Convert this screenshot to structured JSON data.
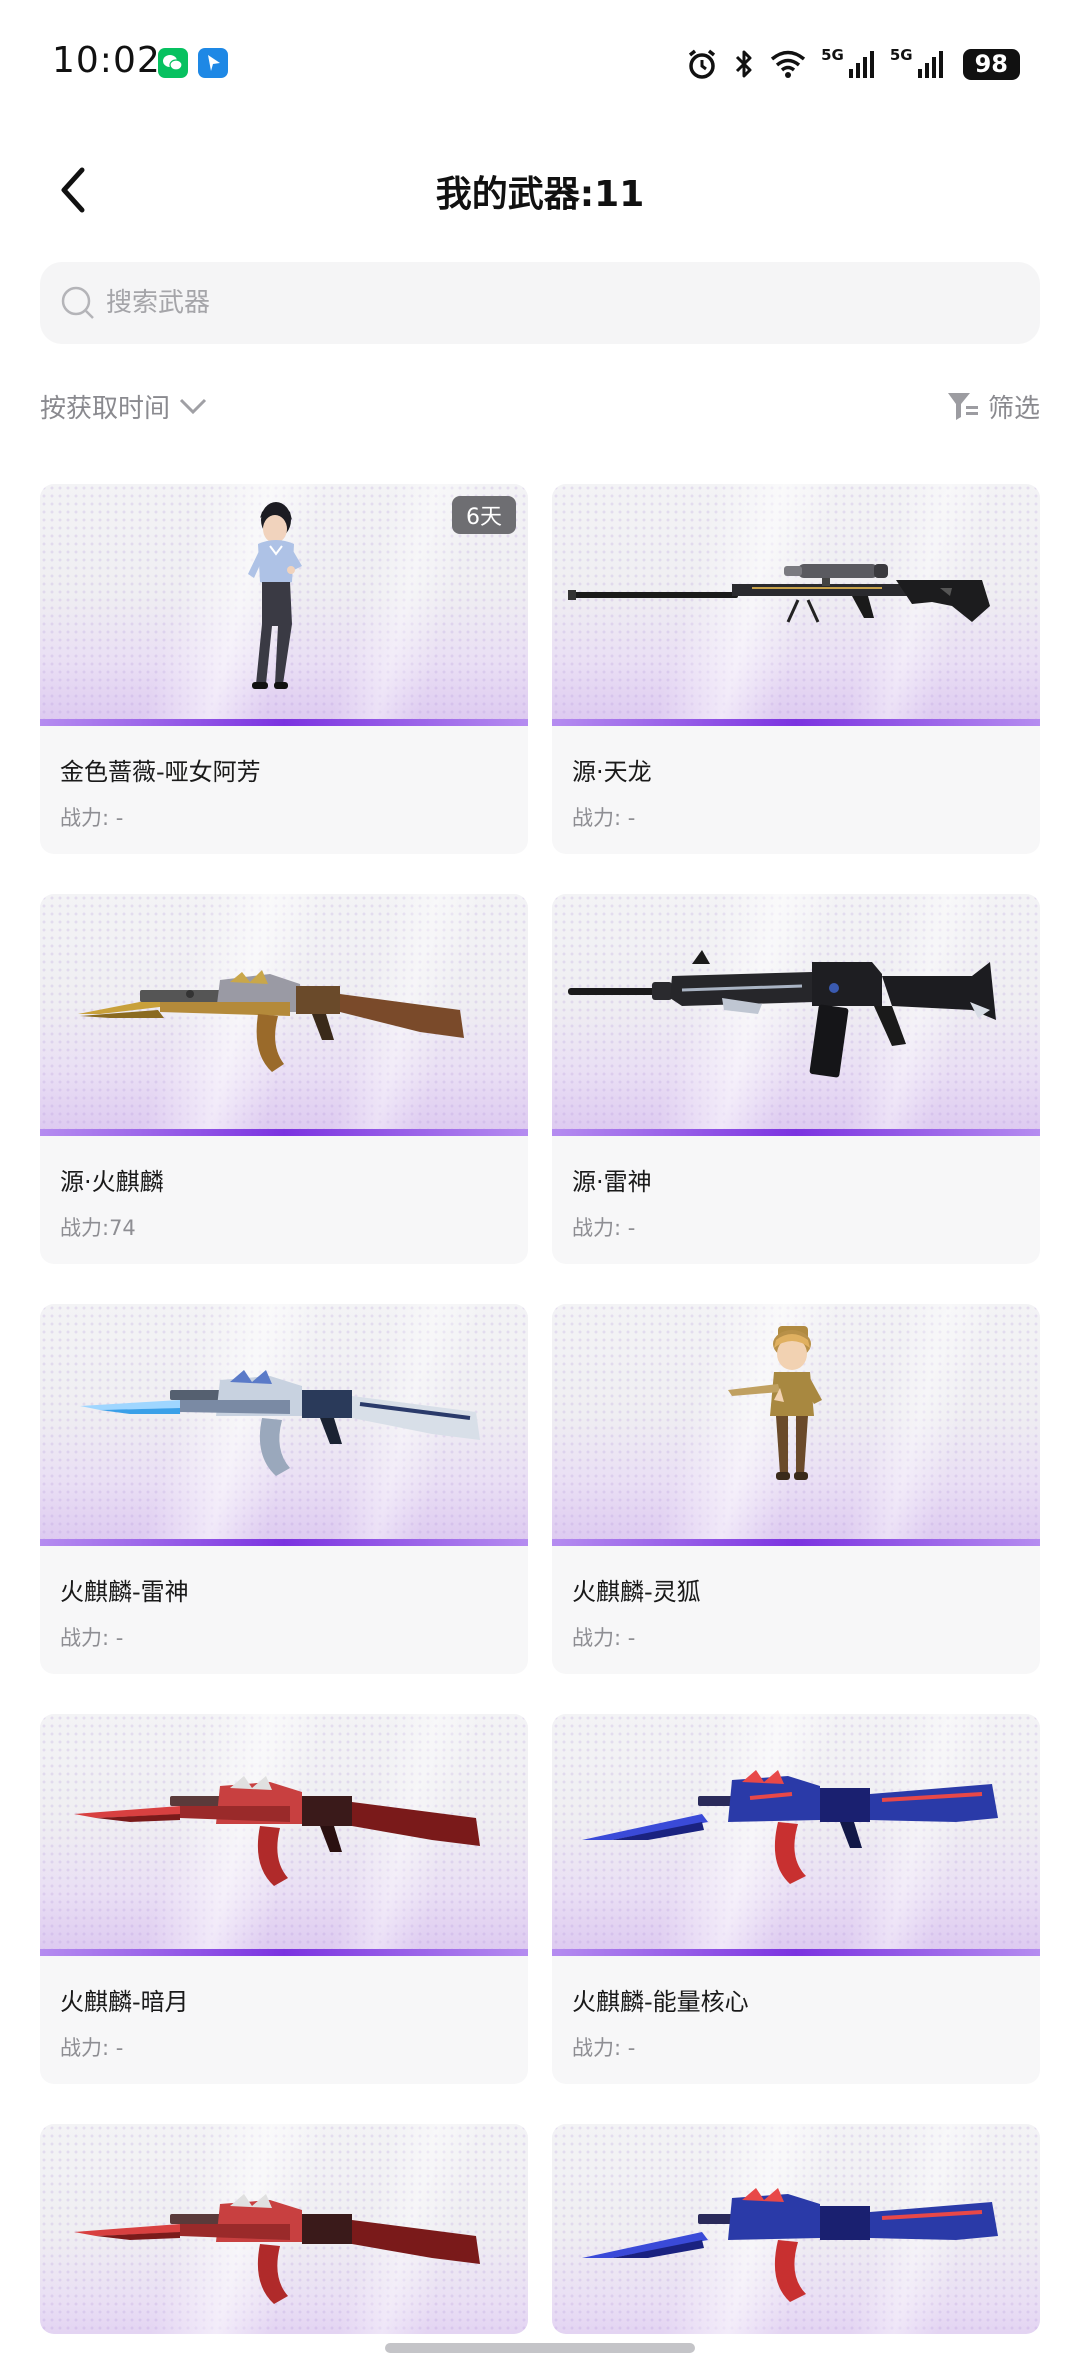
{
  "status_bar": {
    "time": "10:02",
    "icons": [
      "wechat-icon",
      "maps-icon",
      "alarm-icon",
      "bluetooth-icon",
      "wifi-icon",
      "signal-5g-icon",
      "signal-5g-icon"
    ],
    "network_label_1": "5G",
    "network_label_2": "5G",
    "battery": "98"
  },
  "header": {
    "back_icon": "chevron-left-icon",
    "title": "我的武器:11"
  },
  "search": {
    "placeholder": "搜索武器",
    "value": ""
  },
  "toolbar": {
    "sort_label": "按获取时间",
    "filter_label": "筛选"
  },
  "weapons": [
    {
      "name": "金色蔷薇-哑女阿芳",
      "power": "战力: -",
      "badge": "6天",
      "art": "character-woman"
    },
    {
      "name": "源·天龙",
      "power": "战力: -",
      "art": "sniper-rifle"
    },
    {
      "name": "源·火麒麟",
      "power": "战力:74",
      "art": "ak-gold"
    },
    {
      "name": "源·雷神",
      "power": "战力: -",
      "art": "m4-black"
    },
    {
      "name": "火麒麟-雷神",
      "power": "战力: -",
      "art": "ak-blue-silver"
    },
    {
      "name": "火麒麟-灵狐",
      "power": "战力: -",
      "art": "character-girl"
    },
    {
      "name": "火麒麟-暗月",
      "power": "战力: -",
      "art": "ak-red"
    },
    {
      "name": "火麒麟-能量核心",
      "power": "战力: -",
      "art": "ak-blue-red"
    },
    {
      "name": "",
      "power": "",
      "art": "ak-red"
    },
    {
      "name": "",
      "power": "",
      "art": "ak-blue-red"
    }
  ],
  "colors": {
    "rarity_purple": "#7b33e0",
    "card_background": "#f7f7f8",
    "badge_background": "#6e6e72",
    "muted_text": "#8a8a8f"
  }
}
